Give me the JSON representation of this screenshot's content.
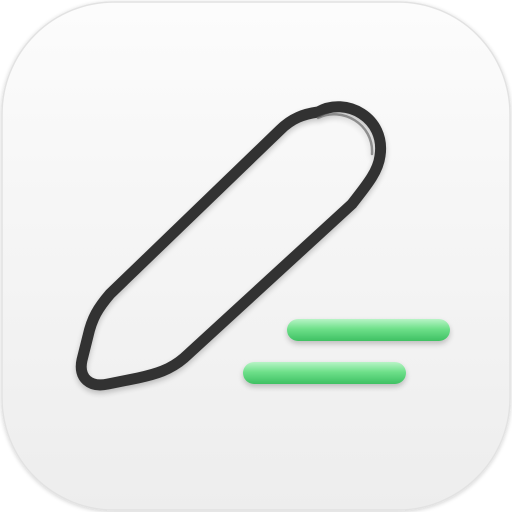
{
  "icon": {
    "name": "compose-pencil-app-icon",
    "depicts": "pencil-writing-lines",
    "colors": {
      "tile_top": "#fcfcfc",
      "tile_bottom": "#ededed",
      "tile_edge": "#e2e2e2",
      "pencil_outline": "#333333",
      "pencil_outline_highlight": "#6a6a6a",
      "line_fill": "#6ee08a",
      "line_highlight": "#b8f4c6",
      "line_edge": "#3fc163"
    },
    "writing_lines_count": 2
  }
}
